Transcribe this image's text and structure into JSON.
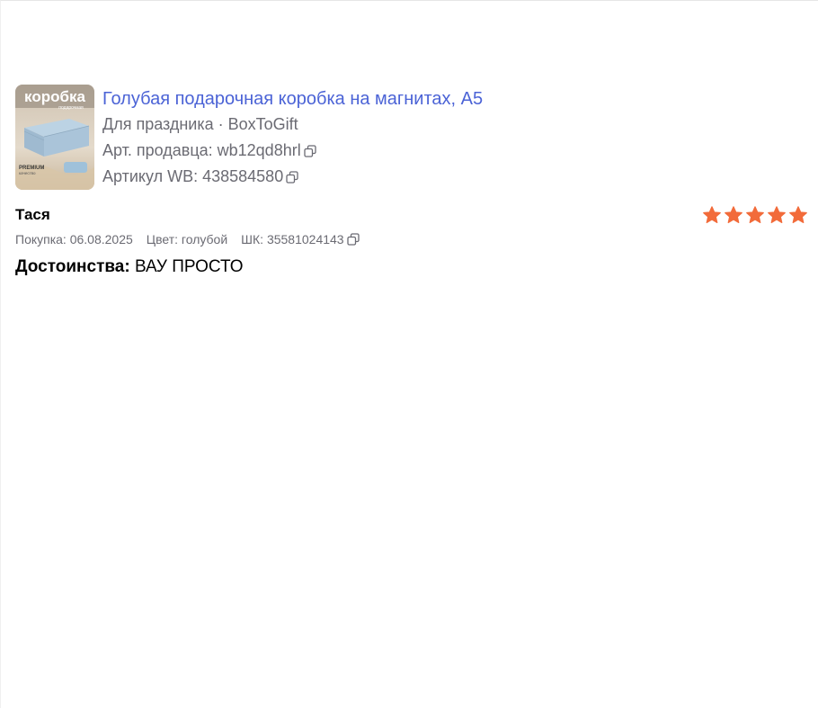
{
  "product": {
    "image_text": "коробка",
    "image_subtext": "подарочная",
    "image_badge": "PREMIUM",
    "image_badge_sub": "качество",
    "title": "Голубая подарочная коробка на магнитах, А5",
    "category": "Для праздника · BoxToGift",
    "seller_article": "Арт. продавца: wb12qd8hrl",
    "wb_article": "Артикул WB: 438584580"
  },
  "review": {
    "author": "Тася",
    "rating": 5,
    "rating_max": 5,
    "purchase": "Покупка: 06.08.2025",
    "color": "Цвет: голубой",
    "shk": "ШК: 35581024143",
    "pros_label": "Достоинства:",
    "pros_text": " ВАУ ПРОСТО"
  },
  "colors": {
    "title_link": "#4b63d6",
    "muted_text": "#6b6b73",
    "star": "#f26b3a"
  },
  "icons": {
    "copy": "copy-icon",
    "star": "star-icon"
  }
}
